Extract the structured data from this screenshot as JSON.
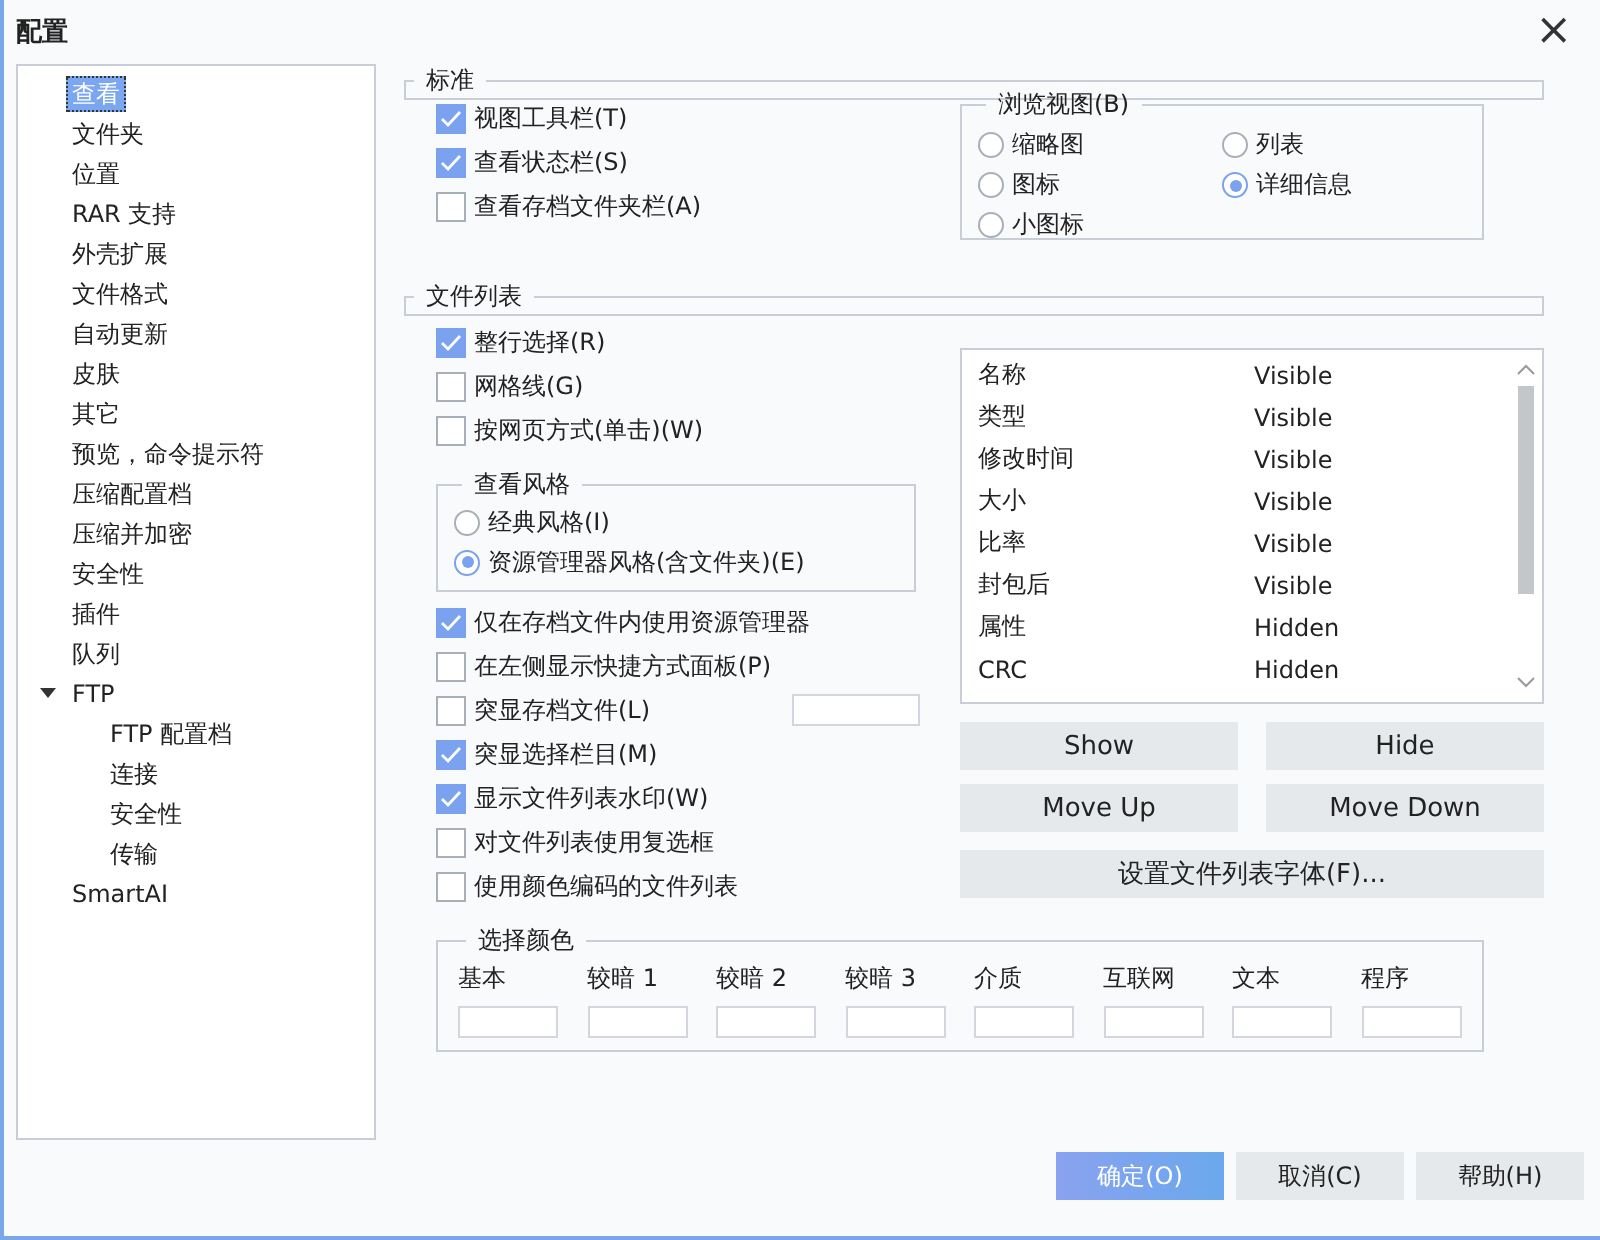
{
  "window": {
    "title": "配置",
    "close": "×"
  },
  "sidebar": {
    "items": [
      {
        "label": "查看",
        "selected": true
      },
      {
        "label": "文件夹",
        "selected": false
      },
      {
        "label": "位置",
        "selected": false
      },
      {
        "label": "RAR 支持",
        "selected": false
      },
      {
        "label": "外壳扩展",
        "selected": false
      },
      {
        "label": "文件格式",
        "selected": false
      },
      {
        "label": "自动更新",
        "selected": false
      },
      {
        "label": "皮肤",
        "selected": false
      },
      {
        "label": "其它",
        "selected": false
      },
      {
        "label": "预览，命令提示符",
        "selected": false
      },
      {
        "label": "压缩配置档",
        "selected": false
      },
      {
        "label": "压缩并加密",
        "selected": false
      },
      {
        "label": "安全性",
        "selected": false
      },
      {
        "label": "插件",
        "selected": false
      },
      {
        "label": "队列",
        "selected": false
      },
      {
        "label": "FTP",
        "selected": false,
        "expanded": true,
        "children": [
          {
            "label": "FTP 配置档",
            "selected": false
          },
          {
            "label": "连接",
            "selected": false
          },
          {
            "label": "安全性",
            "selected": false
          },
          {
            "label": "传输",
            "selected": false
          }
        ]
      },
      {
        "label": "SmartAI",
        "selected": false
      }
    ]
  },
  "standard": {
    "title": "标准",
    "options": [
      {
        "label": "视图工具栏(T)",
        "checked": true,
        "kind": "checkbox"
      },
      {
        "label": "查看状态栏(S)",
        "checked": true,
        "kind": "checkbox"
      },
      {
        "label": "查看存档文件夹栏(A)",
        "checked": false,
        "kind": "checkbox"
      }
    ],
    "browse_view": {
      "title": "浏览视图(B)",
      "options": [
        {
          "label": "缩略图",
          "selected": false
        },
        {
          "label": "列表",
          "selected": false
        },
        {
          "label": "图标",
          "selected": false
        },
        {
          "label": "详细信息",
          "selected": true
        },
        {
          "label": "小图标",
          "selected": false
        }
      ]
    }
  },
  "file_list": {
    "title": "文件列表",
    "options_top": [
      {
        "label": "整行选择(R)",
        "checked": true,
        "kind": "checkbox"
      },
      {
        "label": "网格线(G)",
        "checked": false,
        "kind": "checkbox"
      },
      {
        "label": "按网页方式(单击)(W)",
        "checked": false,
        "kind": "checkbox"
      }
    ],
    "view_style": {
      "title": "查看风格",
      "options": [
        {
          "label": "经典风格(I)",
          "selected": false
        },
        {
          "label": "资源管理器风格(含文件夹)(E)",
          "selected": true
        }
      ]
    },
    "options_bottom": [
      {
        "label": "仅在存档文件内使用资源管理器",
        "checked": true,
        "kind": "checkbox"
      },
      {
        "label": "在左侧显示快捷方式面板(P)",
        "checked": false,
        "kind": "checkbox"
      },
      {
        "label": "突显存档文件(L)",
        "checked": false,
        "kind": "checkbox-with-field"
      },
      {
        "label": "突显选择栏目(M)",
        "checked": true,
        "kind": "checkbox"
      },
      {
        "label": "显示文件列表水印(W)",
        "checked": true,
        "kind": "checkbox"
      },
      {
        "label": "对文件列表使用复选框",
        "checked": false,
        "kind": "checkbox"
      },
      {
        "label": "使用颜色编码的文件列表",
        "checked": false,
        "kind": "checkbox"
      }
    ],
    "columns": [
      {
        "name": "名称",
        "state": "Visible"
      },
      {
        "name": "类型",
        "state": "Visible"
      },
      {
        "name": "修改时间",
        "state": "Visible"
      },
      {
        "name": "大小",
        "state": "Visible"
      },
      {
        "name": "比率",
        "state": "Visible"
      },
      {
        "name": "封包后",
        "state": "Visible"
      },
      {
        "name": "属性",
        "state": "Hidden"
      },
      {
        "name": "CRC",
        "state": "Hidden"
      }
    ],
    "column_buttons": [
      "Show",
      "Hide",
      "Move Up",
      "Move Down"
    ],
    "font_button": "设置文件列表字体(F)..."
  },
  "colors": {
    "title": "选择颜色",
    "items": [
      "基本",
      "较暗 1",
      "较暗 2",
      "较暗 3",
      "介质",
      "互联网",
      "文本",
      "程序"
    ]
  },
  "footer_buttons": [
    {
      "label": "确定(O)",
      "kind": "primary"
    },
    {
      "label": "取消(C)",
      "kind": "normal"
    },
    {
      "label": "帮助(H)",
      "kind": "normal"
    }
  ]
}
